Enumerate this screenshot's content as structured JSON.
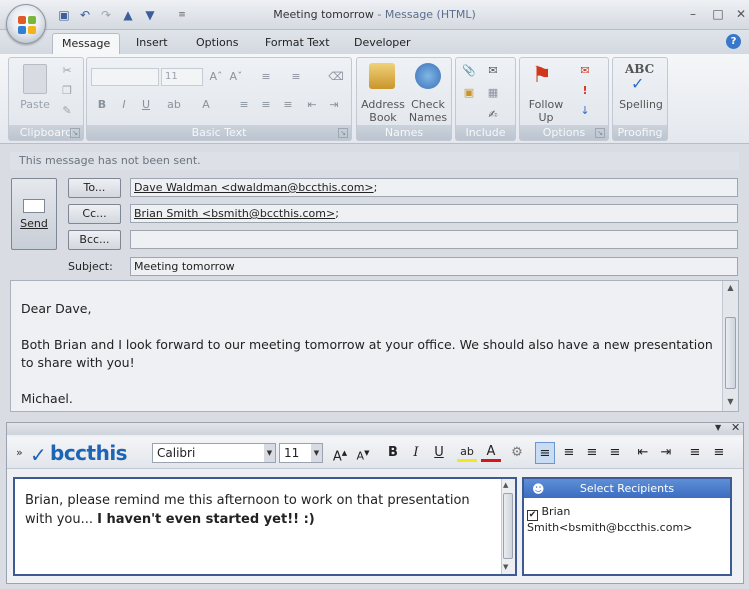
{
  "window": {
    "title": "Meeting tomorrow",
    "title_suffix": " - Message (HTML)"
  },
  "tabs": [
    "Message",
    "Insert",
    "Options",
    "Format Text",
    "Developer"
  ],
  "ribbon": {
    "clipboard": {
      "caption": "Clipboard",
      "paste_label": "Paste"
    },
    "basic_text": {
      "caption": "Basic Text",
      "font_size": "11"
    },
    "names": {
      "caption": "Names",
      "address_book_label": "Address Book",
      "check_names_label": "Check Names"
    },
    "include": {
      "caption": "Include"
    },
    "options": {
      "caption": "Options",
      "follow_up_label": "Follow Up"
    },
    "proofing": {
      "caption": "Proofing",
      "spelling_label": "Spelling",
      "abc": "ABC"
    }
  },
  "infobar": "This message has not been sent.",
  "send_label": "Send",
  "header": {
    "to_label": "To...",
    "to_value": "Dave Waldman <dwaldman@bccthis.com>",
    "cc_label": "Cc...",
    "cc_value": "Brian Smith <bsmith@bccthis.com>",
    "bcc_label": "Bcc...",
    "bcc_value": "",
    "subject_label": "Subject:",
    "subject_value": "Meeting tomorrow"
  },
  "body": {
    "greeting": "Dear Dave,",
    "paragraph": "Both Brian and I look forward to our meeting tomorrow at your office. We should also have a new presentation to share with you!",
    "signature": "Michael."
  },
  "plugin": {
    "logo_text": "bccthis",
    "font": "Calibri",
    "size": "11",
    "text_normal": "Brian, please remind me this afternoon to work on that presentation with you...",
    "text_bold": "I haven't even started yet!! :)",
    "recipients_header": "Select Recipients",
    "recipients": [
      {
        "label": "Brian Smith<bsmith@bccthis.com>",
        "checked": true
      }
    ]
  },
  "colors": {
    "accent": "#3d5a92",
    "header_blue": "#3b6cc0",
    "logo_blue": "#1e64b4"
  }
}
